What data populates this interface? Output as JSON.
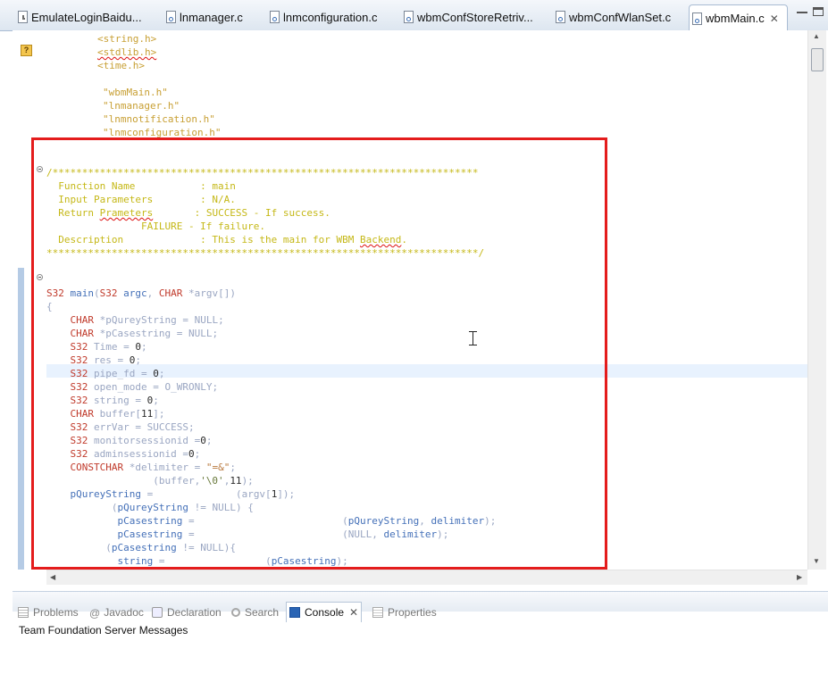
{
  "editor_tabs": [
    {
      "label": "EmulateLoginBaidu...",
      "icon": "java-file-icon",
      "active": false
    },
    {
      "label": "lnmanager.c",
      "icon": "c-file-icon",
      "active": false
    },
    {
      "label": "lnmconfiguration.c",
      "icon": "c-file-icon",
      "active": false
    },
    {
      "label": "wbmConfStoreRetriv...",
      "icon": "c-file-icon",
      "active": false
    },
    {
      "label": "wbmConfWlanSet.c",
      "icon": "c-file-icon",
      "active": false
    },
    {
      "label": "wbmMain.c",
      "icon": "c-file-icon",
      "active": true,
      "close": "✕"
    }
  ],
  "editor": {
    "warning_marker": "?",
    "lines": [
      [
        {
          "t": "<string.h>",
          "c": "inc"
        }
      ],
      [
        {
          "t": "<stdlib.h>",
          "c": "inc squig"
        }
      ],
      [
        {
          "t": "<time.h>",
          "c": "inc"
        }
      ],
      [],
      [
        {
          "t": "\"wbmMain.h\"",
          "c": "inc"
        }
      ],
      [
        {
          "t": "\"lnmanager.h\"",
          "c": "inc"
        }
      ],
      [
        {
          "t": "\"lnmnotification.h\"",
          "c": "inc"
        }
      ],
      [
        {
          "t": "\"lnmconfiguration.h\"",
          "c": "inc"
        }
      ],
      [],
      [],
      [
        {
          "t": "/************************************************************************",
          "c": "cm"
        }
      ],
      [
        {
          "t": "  Function Name           : main",
          "c": "cm"
        }
      ],
      [
        {
          "t": "  Input Parameters        : N/A.",
          "c": "cm"
        }
      ],
      [
        {
          "t": "  Return ",
          "c": "cm"
        },
        {
          "t": "Prameters",
          "c": "cm squig"
        },
        {
          "t": "       : SUCCESS - If success.",
          "c": "cm"
        }
      ],
      [
        {
          "t": "                FAILURE - If failure.",
          "c": "cm"
        }
      ],
      [
        {
          "t": "  Description             : This is the main for WBM ",
          "c": "cm"
        },
        {
          "t": "Backend",
          "c": "cm squig"
        },
        {
          "t": ".",
          "c": "cm"
        }
      ],
      [
        {
          "t": "*************************************************************************/",
          "c": "cm"
        }
      ],
      [],
      [],
      [
        {
          "t": "S32",
          "c": "ty"
        },
        {
          "t": " main",
          "c": "fn"
        },
        {
          "t": "(",
          "c": "kw"
        },
        {
          "t": "S32",
          "c": "ty"
        },
        {
          "t": " argc",
          "c": "fn"
        },
        {
          "t": ", ",
          "c": "kw"
        },
        {
          "t": "CHAR",
          "c": "ty"
        },
        {
          "t": " *argv[])",
          "c": "kw"
        }
      ],
      [
        {
          "t": "{",
          "c": "kw"
        }
      ],
      [
        {
          "t": "    "
        },
        {
          "t": "CHAR",
          "c": "ty"
        },
        {
          "t": " *pQureyString = NULL;",
          "c": "kw"
        }
      ],
      [
        {
          "t": "    "
        },
        {
          "t": "CHAR",
          "c": "ty"
        },
        {
          "t": " *pCasestring = NULL;",
          "c": "kw"
        }
      ],
      [
        {
          "t": "    "
        },
        {
          "t": "S32",
          "c": "ty"
        },
        {
          "t": " Time = ",
          "c": "kw"
        },
        {
          "t": "0",
          "c": "num"
        },
        {
          "t": ";",
          "c": "kw"
        }
      ],
      [
        {
          "t": "    "
        },
        {
          "t": "S32",
          "c": "ty"
        },
        {
          "t": " res = ",
          "c": "kw"
        },
        {
          "t": "0",
          "c": "num"
        },
        {
          "t": ";",
          "c": "kw"
        }
      ],
      [
        {
          "t": "    "
        },
        {
          "t": "S32",
          "c": "ty"
        },
        {
          "t": " pipe_fd = ",
          "c": "kw"
        },
        {
          "t": "0",
          "c": "num"
        },
        {
          "t": ";",
          "c": "kw"
        }
      ],
      [
        {
          "t": "    "
        },
        {
          "t": "S32",
          "c": "ty"
        },
        {
          "t": " open_mode = O_WRONLY;",
          "c": "kw"
        }
      ],
      [
        {
          "t": "    "
        },
        {
          "t": "S32",
          "c": "ty"
        },
        {
          "t": " string = ",
          "c": "kw"
        },
        {
          "t": "0",
          "c": "num"
        },
        {
          "t": ";",
          "c": "kw"
        }
      ],
      [
        {
          "t": "    "
        },
        {
          "t": "CHAR",
          "c": "ty"
        },
        {
          "t": " buffer[",
          "c": "kw"
        },
        {
          "t": "11",
          "c": "num"
        },
        {
          "t": "];",
          "c": "kw"
        }
      ],
      [
        {
          "t": "    "
        },
        {
          "t": "S32",
          "c": "ty"
        },
        {
          "t": " errVar = SUCCESS;",
          "c": "kw"
        }
      ],
      [
        {
          "t": "    "
        },
        {
          "t": "S32",
          "c": "ty"
        },
        {
          "t": " monitorsessionid =",
          "c": "kw"
        },
        {
          "t": "0",
          "c": "num"
        },
        {
          "t": ";",
          "c": "kw"
        }
      ],
      [
        {
          "t": "    "
        },
        {
          "t": "S32",
          "c": "ty"
        },
        {
          "t": " adminsessionid =",
          "c": "kw"
        },
        {
          "t": "0",
          "c": "num"
        },
        {
          "t": ";",
          "c": "kw"
        }
      ],
      [
        {
          "t": "    "
        },
        {
          "t": "CONSTCHAR",
          "c": "ty"
        },
        {
          "t": " *delimiter = ",
          "c": "kw"
        },
        {
          "t": "\"=&\"",
          "c": "str"
        },
        {
          "t": ";",
          "c": "kw"
        }
      ],
      [
        {
          "t": "                  (buffer,",
          "c": "kw"
        },
        {
          "t": "'\\0'",
          "c": "chr"
        },
        {
          "t": ",",
          "c": "kw"
        },
        {
          "t": "11",
          "c": "num"
        },
        {
          "t": ");",
          "c": "kw"
        }
      ],
      [
        {
          "t": "    "
        },
        {
          "t": "pQureyString",
          "c": "fn"
        },
        {
          "t": " =              (argv[",
          "c": "kw"
        },
        {
          "t": "1",
          "c": "num"
        },
        {
          "t": "]);",
          "c": "kw"
        }
      ],
      [
        {
          "t": "           (",
          "c": "kw"
        },
        {
          "t": "pQureyString",
          "c": "fn"
        },
        {
          "t": " != NULL) {",
          "c": "kw"
        }
      ],
      [
        {
          "t": "            "
        },
        {
          "t": "pCasestring",
          "c": "fn"
        },
        {
          "t": " =                         (",
          "c": "kw"
        },
        {
          "t": "pQureyString",
          "c": "fn"
        },
        {
          "t": ", ",
          "c": "kw"
        },
        {
          "t": "delimiter",
          "c": "fn"
        },
        {
          "t": ");",
          "c": "kw"
        }
      ],
      [
        {
          "t": "            "
        },
        {
          "t": "pCasestring",
          "c": "fn"
        },
        {
          "t": " =                         (NULL, ",
          "c": "kw"
        },
        {
          "t": "delimiter",
          "c": "fn"
        },
        {
          "t": ");",
          "c": "kw"
        }
      ],
      [
        {
          "t": "          (",
          "c": "kw"
        },
        {
          "t": "pCasestring",
          "c": "fn"
        },
        {
          "t": " != NULL){",
          "c": "kw"
        }
      ],
      [
        {
          "t": "            "
        },
        {
          "t": "string",
          "c": "fn"
        },
        {
          "t": " =                 (",
          "c": "kw"
        },
        {
          "t": "pCasestring",
          "c": "fn"
        },
        {
          "t": ");",
          "c": "kw"
        }
      ],
      [
        {
          "t": "        }",
          "c": "kw"
        }
      ]
    ]
  },
  "bottom_views": {
    "tabs": [
      {
        "label": "Problems",
        "icon": "problems-icon",
        "active": false
      },
      {
        "label": "Javadoc",
        "icon": "at-icon",
        "active": false
      },
      {
        "label": "Declaration",
        "icon": "declaration-icon",
        "active": false
      },
      {
        "label": "Search",
        "icon": "search-icon",
        "active": false
      },
      {
        "label": "Console",
        "icon": "console-icon",
        "active": true,
        "close": "✕"
      },
      {
        "label": "Properties",
        "icon": "properties-icon",
        "active": false
      }
    ],
    "console_title": "Team Foundation Server Messages"
  },
  "annotation_color": "#e41c1c"
}
